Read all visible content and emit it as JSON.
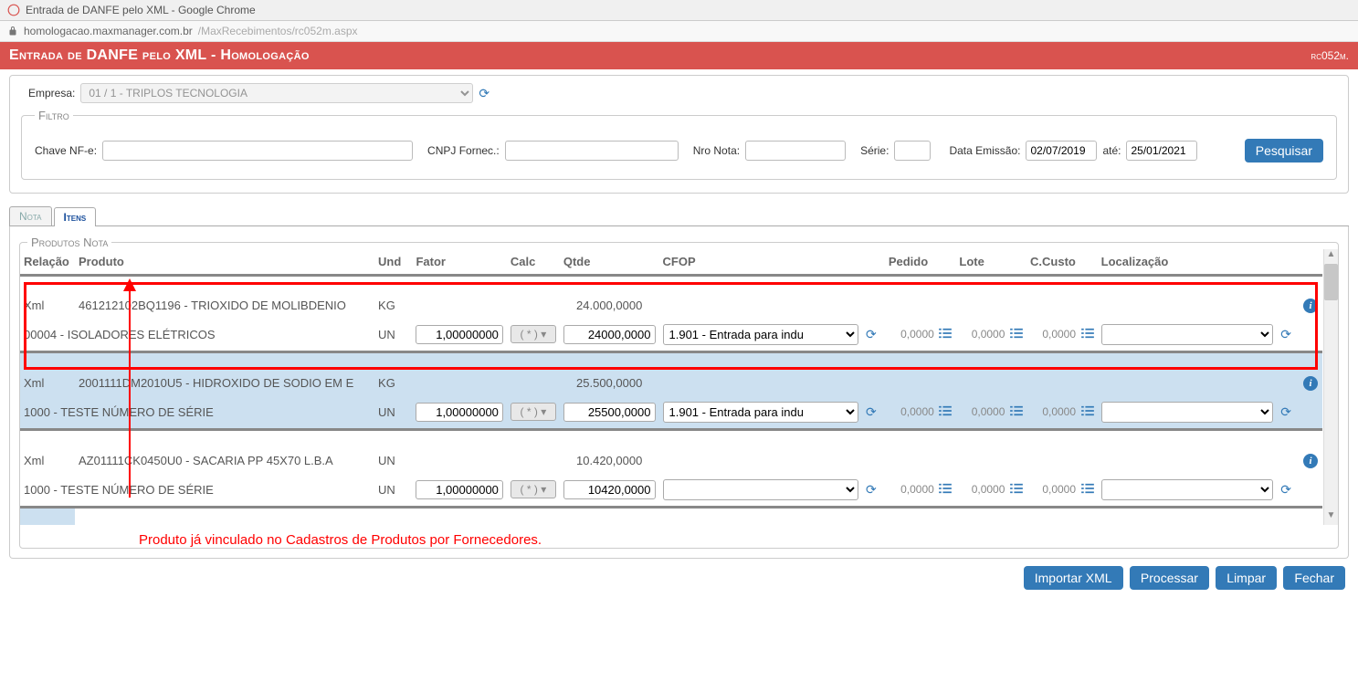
{
  "window": {
    "title": "Entrada de DANFE pelo XML - Google Chrome"
  },
  "url": {
    "host": "homologacao.maxmanager.com.br",
    "path": "/MaxRecebimentos/rc052m.aspx"
  },
  "page_header": {
    "title": "Entrada de DANFE pelo XML  - Homologação",
    "code": "rc052m."
  },
  "empresa": {
    "label": "Empresa:",
    "value": "01 / 1 - TRIPLOS TECNOLOGIA"
  },
  "filtro": {
    "legend": "Filtro",
    "chave_label": "Chave NF-e:",
    "cnpj_label": "CNPJ Fornec.:",
    "nro_label": "Nro Nota:",
    "serie_label": "Série:",
    "data_label": "Data Emissão:",
    "data_de": "02/07/2019",
    "ate_label": "até:",
    "data_ate": "25/01/2021",
    "pesquisar": "Pesquisar"
  },
  "tabs": {
    "nota": "Nota",
    "itens": "Itens"
  },
  "produtos_legend": "Produtos Nota",
  "headers": {
    "relacao": "Relação",
    "produto": "Produto",
    "und": "Und",
    "fator": "Fator",
    "calc": "Calc",
    "qtde": "Qtde",
    "cfop": "CFOP",
    "pedido": "Pedido",
    "lote": "Lote",
    "ccusto": "C.Custo",
    "loc": "Localização"
  },
  "rows": [
    {
      "xml": {
        "relacao": "Xml",
        "produto": "461212102BQ1196 - TRIOXIDO DE MOLIBDENIO",
        "und": "KG",
        "qtde": "24.000,0000"
      },
      "item": {
        "produto": "00004 - ISOLADORES ELÉTRICOS",
        "und": "UN",
        "fator": "1,00000000",
        "calc": "( * )",
        "qtde": "24000,0000",
        "cfop": "1.901 - Entrada para indu",
        "pedido": "0,0000",
        "lote": "0,0000",
        "ccusto": "0,0000",
        "loc": ""
      }
    },
    {
      "xml": {
        "relacao": "Xml",
        "produto": "2001111DM2010U5 - HIDROXIDO DE SODIO EM E",
        "und": "KG",
        "qtde": "25.500,0000"
      },
      "item": {
        "produto": "1000 - TESTE NÚMERO DE SÉRIE",
        "und": "UN",
        "fator": "1,00000000",
        "calc": "( * )",
        "qtde": "25500,0000",
        "cfop": "1.901 - Entrada para indu",
        "pedido": "0,0000",
        "lote": "0,0000",
        "ccusto": "0,0000",
        "loc": ""
      }
    },
    {
      "xml": {
        "relacao": "Xml",
        "produto": "AZ01111CK0450U0 - SACARIA PP 45X70 L.B.A",
        "und": "UN",
        "qtde": "10.420,0000"
      },
      "item": {
        "produto": "1000 - TESTE NÚMERO DE SÉRIE",
        "und": "UN",
        "fator": "1,00000000",
        "calc": "( * )",
        "qtde": "10420,0000",
        "cfop": "",
        "pedido": "0,0000",
        "lote": "0,0000",
        "ccusto": "0,0000",
        "loc": ""
      }
    }
  ],
  "annotation": "Produto já vinculado no Cadastros de Produtos por Fornecedores.",
  "footer": {
    "importar": "Importar XML",
    "processar": "Processar",
    "limpar": "Limpar",
    "fechar": "Fechar"
  }
}
